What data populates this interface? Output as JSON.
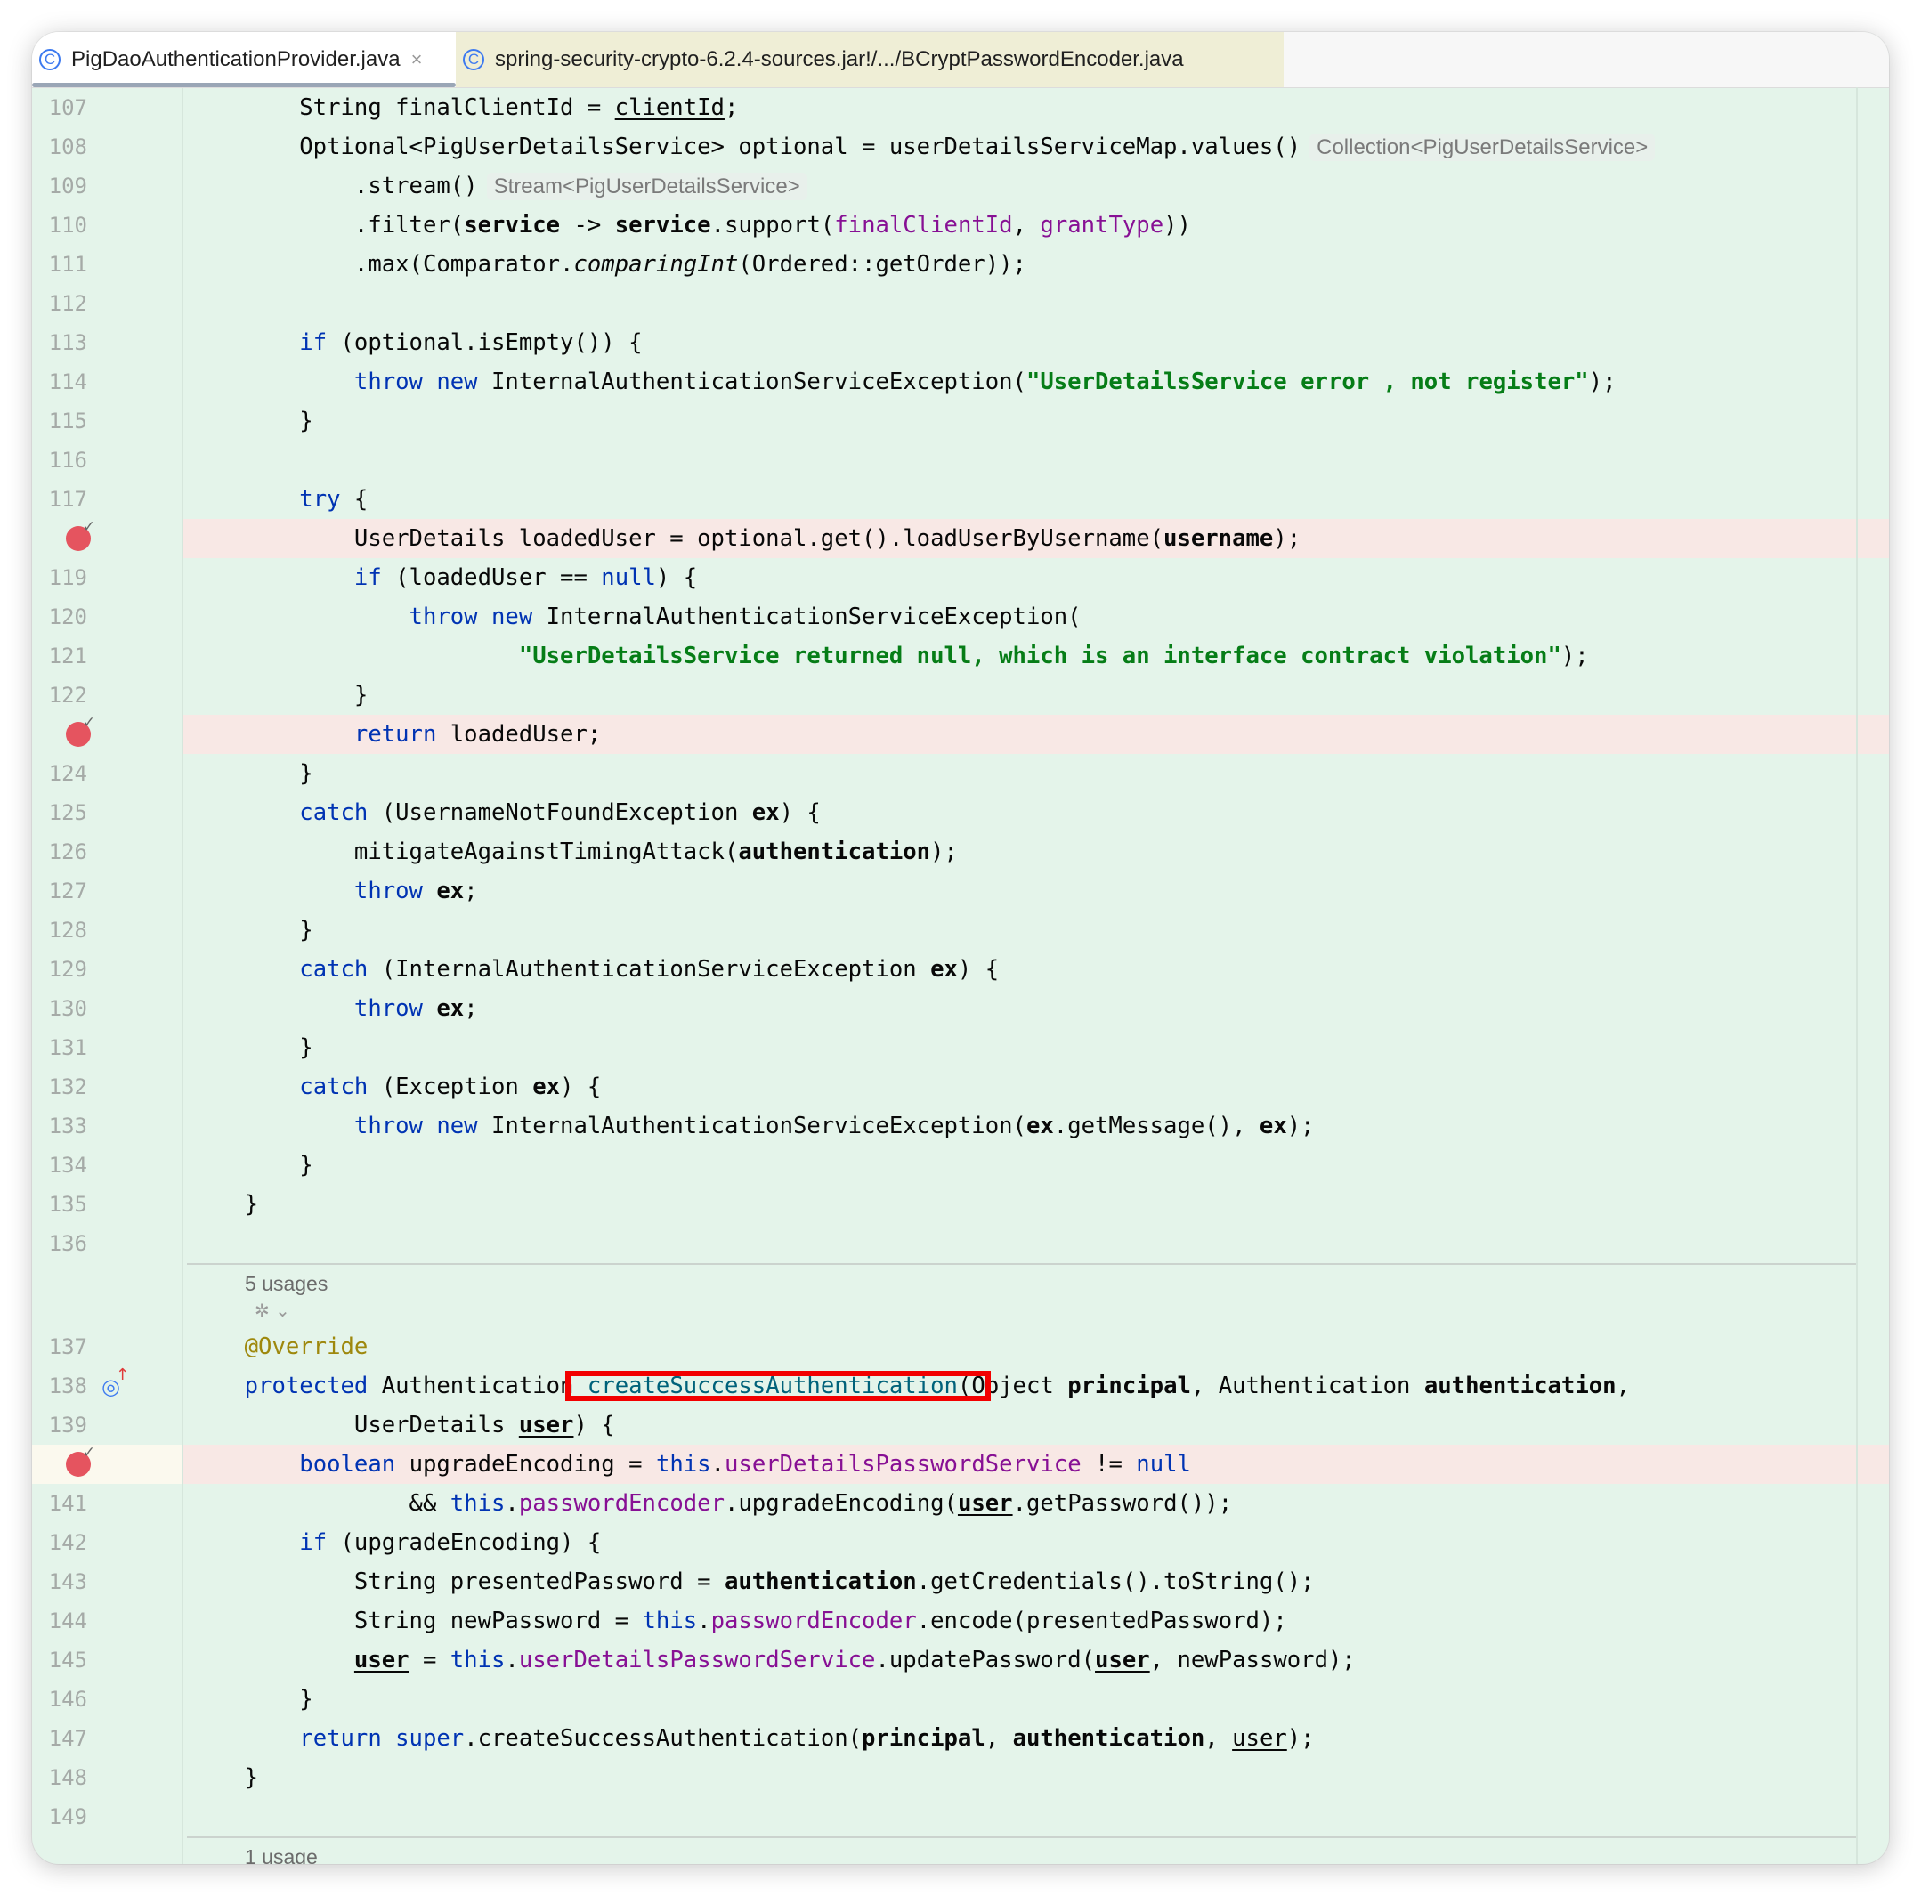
{
  "tabs": [
    {
      "label": "PigDaoAuthenticationProvider.java",
      "icon": "class-icon",
      "active": true
    },
    {
      "label": "spring-security-crypto-6.2.4-sources.jar!/.../BCryptPasswordEncoder.java",
      "icon": "class-icon",
      "active": false
    }
  ],
  "colors": {
    "keyword": "#0033b3",
    "string": "#067d17",
    "field": "#871094",
    "method_decl": "#00627a",
    "annotation": "#9e880d",
    "background": "#e4f4ea",
    "breakpoint_line": "#f8e8e5",
    "breakpoint": "#e5545f",
    "highlight_box": "#f20000"
  },
  "usages": [
    "5 usages",
    "1 usage"
  ],
  "lines": [
    {
      "n": "107",
      "segs": [
        [
          "        String finalClientId = ",
          ""
        ],
        [
          "clientId",
          "u"
        ],
        [
          ";",
          ""
        ]
      ]
    },
    {
      "n": "108",
      "segs": [
        [
          "        Optional<PigUserDetailsService> optional = userDetailsServiceMap.values()",
          ""
        ],
        [
          "Collection<PigUserDetailsService>",
          "h"
        ]
      ]
    },
    {
      "n": "109",
      "segs": [
        [
          "            .stream()",
          ""
        ],
        [
          "Stream<PigUserDetailsService>",
          "h"
        ]
      ]
    },
    {
      "n": "110",
      "segs": [
        [
          "            .filter(",
          ""
        ],
        [
          "service",
          "b"
        ],
        [
          " -> ",
          ""
        ],
        [
          "service",
          "b"
        ],
        [
          ".support(",
          ""
        ],
        [
          "finalClientId",
          "f"
        ],
        [
          ", ",
          ""
        ],
        [
          "grantType",
          "f"
        ],
        [
          "))",
          ""
        ]
      ]
    },
    {
      "n": "111",
      "segs": [
        [
          "            .max(Comparator.",
          ""
        ],
        [
          "comparingInt",
          "i"
        ],
        [
          "(Ordered::getOrder));",
          ""
        ]
      ]
    },
    {
      "n": "112",
      "segs": []
    },
    {
      "n": "113",
      "segs": [
        [
          "        ",
          ""
        ],
        [
          "if",
          "k"
        ],
        [
          " (optional.isEmpty()) {",
          ""
        ]
      ]
    },
    {
      "n": "114",
      "segs": [
        [
          "            ",
          ""
        ],
        [
          "throw new",
          "k"
        ],
        [
          " InternalAuthenticationServiceException(",
          ""
        ],
        [
          "\"UserDetailsService error , not register\"",
          "s"
        ],
        [
          ");",
          ""
        ]
      ]
    },
    {
      "n": "115",
      "segs": [
        [
          "        }",
          ""
        ]
      ]
    },
    {
      "n": "116",
      "segs": []
    },
    {
      "n": "117",
      "segs": [
        [
          "        ",
          ""
        ],
        [
          "try",
          "k"
        ],
        [
          " {",
          ""
        ]
      ]
    },
    {
      "n": "118",
      "bp": true,
      "segs": [
        [
          "            UserDetails loadedUser = optional.get().loadUserByUsername(",
          ""
        ],
        [
          "username",
          "b"
        ],
        [
          ");",
          ""
        ]
      ]
    },
    {
      "n": "119",
      "segs": [
        [
          "            ",
          ""
        ],
        [
          "if",
          "k"
        ],
        [
          " (loadedUser == ",
          ""
        ],
        [
          "null",
          "k"
        ],
        [
          ") {",
          ""
        ]
      ]
    },
    {
      "n": "120",
      "segs": [
        [
          "                ",
          ""
        ],
        [
          "throw new",
          "k"
        ],
        [
          " InternalAuthenticationServiceException(",
          ""
        ]
      ]
    },
    {
      "n": "121",
      "segs": [
        [
          "                        ",
          ""
        ],
        [
          "\"UserDetailsService returned null, which is an interface contract violation\"",
          "s"
        ],
        [
          ");",
          ""
        ]
      ]
    },
    {
      "n": "122",
      "segs": [
        [
          "            }",
          ""
        ]
      ]
    },
    {
      "n": "123",
      "bp": true,
      "segs": [
        [
          "            ",
          ""
        ],
        [
          "return",
          "k"
        ],
        [
          " loadedUser;",
          ""
        ]
      ]
    },
    {
      "n": "124",
      "segs": [
        [
          "        }",
          ""
        ]
      ]
    },
    {
      "n": "125",
      "segs": [
        [
          "        ",
          ""
        ],
        [
          "catch",
          "k"
        ],
        [
          " (UsernameNotFoundException ",
          ""
        ],
        [
          "ex",
          "b"
        ],
        [
          ") {",
          ""
        ]
      ]
    },
    {
      "n": "126",
      "segs": [
        [
          "            mitigateAgainstTimingAttack(",
          ""
        ],
        [
          "authentication",
          "b"
        ],
        [
          ");",
          ""
        ]
      ]
    },
    {
      "n": "127",
      "segs": [
        [
          "            ",
          ""
        ],
        [
          "throw",
          "k"
        ],
        [
          " ",
          ""
        ],
        [
          "ex",
          "b"
        ],
        [
          ";",
          ""
        ]
      ]
    },
    {
      "n": "128",
      "segs": [
        [
          "        }",
          ""
        ]
      ]
    },
    {
      "n": "129",
      "segs": [
        [
          "        ",
          ""
        ],
        [
          "catch",
          "k"
        ],
        [
          " (InternalAuthenticationServiceException ",
          ""
        ],
        [
          "ex",
          "b"
        ],
        [
          ") {",
          ""
        ]
      ]
    },
    {
      "n": "130",
      "segs": [
        [
          "            ",
          ""
        ],
        [
          "throw",
          "k"
        ],
        [
          " ",
          ""
        ],
        [
          "ex",
          "b"
        ],
        [
          ";",
          ""
        ]
      ]
    },
    {
      "n": "131",
      "segs": [
        [
          "        }",
          ""
        ]
      ]
    },
    {
      "n": "132",
      "segs": [
        [
          "        ",
          ""
        ],
        [
          "catch",
          "k"
        ],
        [
          " (Exception ",
          ""
        ],
        [
          "ex",
          "b"
        ],
        [
          ") {",
          ""
        ]
      ]
    },
    {
      "n": "133",
      "segs": [
        [
          "            ",
          ""
        ],
        [
          "throw new",
          "k"
        ],
        [
          " InternalAuthenticationServiceException(",
          ""
        ],
        [
          "ex",
          "b"
        ],
        [
          ".getMessage(), ",
          ""
        ],
        [
          "ex",
          "b"
        ],
        [
          ");",
          ""
        ]
      ]
    },
    {
      "n": "134",
      "segs": [
        [
          "        }",
          ""
        ]
      ]
    },
    {
      "n": "135",
      "segs": [
        [
          "    }",
          ""
        ]
      ]
    },
    {
      "n": "136",
      "segs": []
    },
    {
      "usage": "5 usages"
    },
    {
      "n": "137",
      "segs": [
        [
          "    ",
          ""
        ],
        [
          "@Override",
          "a"
        ]
      ]
    },
    {
      "n": "138",
      "override": true,
      "segs": [
        [
          "    ",
          ""
        ],
        [
          "protected",
          "k"
        ],
        [
          " Authentication ",
          ""
        ],
        [
          "createSuccessAuthentication",
          "m box"
        ],
        [
          "(Object ",
          ""
        ],
        [
          "principal",
          "b"
        ],
        [
          ", Authentication ",
          ""
        ],
        [
          "authentication",
          "b"
        ],
        [
          ",",
          ""
        ]
      ]
    },
    {
      "n": "139",
      "segs": [
        [
          "            UserDetails ",
          ""
        ],
        [
          "user",
          "ub"
        ],
        [
          ") {",
          ""
        ]
      ]
    },
    {
      "n": "140",
      "bp": true,
      "cur": true,
      "segs": [
        [
          "        ",
          ""
        ],
        [
          "boolean",
          "k"
        ],
        [
          " upgradeEncoding = ",
          ""
        ],
        [
          "this",
          "k"
        ],
        [
          ".",
          ""
        ],
        [
          "userDetailsPasswordService",
          "f"
        ],
        [
          " != ",
          ""
        ],
        [
          "null",
          "k"
        ]
      ]
    },
    {
      "n": "141",
      "segs": [
        [
          "                && ",
          ""
        ],
        [
          "this",
          "k"
        ],
        [
          ".",
          ""
        ],
        [
          "passwordEncoder",
          "f"
        ],
        [
          ".upgradeEncoding(",
          ""
        ],
        [
          "user",
          "ub"
        ],
        [
          ".getPassword());",
          ""
        ]
      ]
    },
    {
      "n": "142",
      "segs": [
        [
          "        ",
          ""
        ],
        [
          "if",
          "k"
        ],
        [
          " (upgradeEncoding) {",
          ""
        ]
      ]
    },
    {
      "n": "143",
      "segs": [
        [
          "            String presentedPassword = ",
          ""
        ],
        [
          "authentication",
          "b"
        ],
        [
          ".getCredentials().toString();",
          ""
        ]
      ]
    },
    {
      "n": "144",
      "segs": [
        [
          "            String newPassword = ",
          ""
        ],
        [
          "this",
          "k"
        ],
        [
          ".",
          ""
        ],
        [
          "passwordEncoder",
          "f"
        ],
        [
          ".encode(presentedPassword);",
          ""
        ]
      ]
    },
    {
      "n": "145",
      "segs": [
        [
          "            ",
          ""
        ],
        [
          "user",
          "ub"
        ],
        [
          " = ",
          ""
        ],
        [
          "this",
          "k"
        ],
        [
          ".",
          ""
        ],
        [
          "userDetailsPasswordService",
          "f"
        ],
        [
          ".updatePassword(",
          ""
        ],
        [
          "user",
          "ub"
        ],
        [
          ", newPassword);",
          ""
        ]
      ]
    },
    {
      "n": "146",
      "segs": [
        [
          "        }",
          ""
        ]
      ]
    },
    {
      "n": "147",
      "segs": [
        [
          "        ",
          ""
        ],
        [
          "return super",
          "k"
        ],
        [
          ".createSuccessAuthentication(",
          ""
        ],
        [
          "principal",
          "b"
        ],
        [
          ", ",
          ""
        ],
        [
          "authentication",
          "b"
        ],
        [
          ", ",
          ""
        ],
        [
          "user",
          "u"
        ],
        [
          ");",
          ""
        ]
      ]
    },
    {
      "n": "148",
      "segs": [
        [
          "    }",
          ""
        ]
      ]
    },
    {
      "n": "149",
      "segs": []
    },
    {
      "usage": "1 usage"
    }
  ]
}
